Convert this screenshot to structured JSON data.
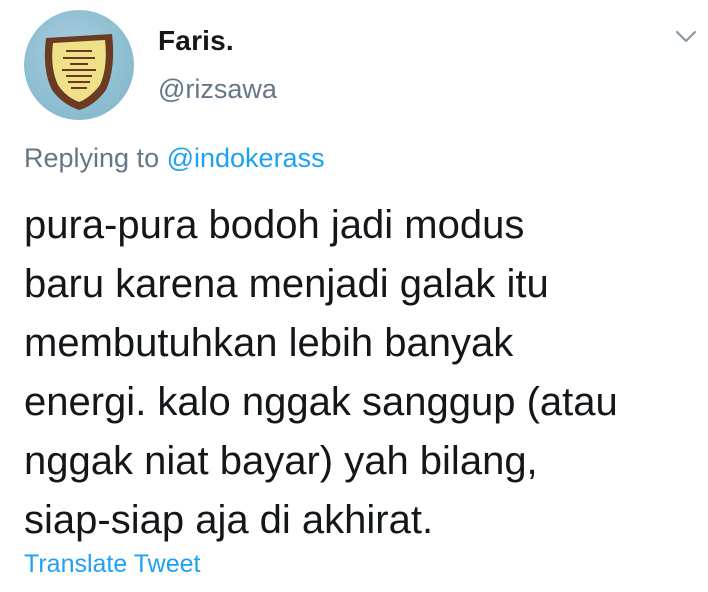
{
  "author": {
    "display_name": "Faris.",
    "username": "@rizsawa",
    "avatar_icon": "shield-plaque-icon"
  },
  "menu": {
    "icon": "chevron-down-icon"
  },
  "reply_context": {
    "prefix": "Replying to ",
    "handle": "@indokerass"
  },
  "tweet": {
    "lines": [
      "pura-pura bodoh jadi modus",
      "baru karena menjadi galak itu",
      "membutuhkan lebih banyak",
      "energi. kalo nggak sanggup (atau",
      "nggak niat bayar) yah bilang,",
      "siap-siap aja di akhirat."
    ]
  },
  "actions": {
    "translate_label": "Translate Tweet"
  },
  "colors": {
    "link": "#1da1f2",
    "secondary_text": "#657786",
    "primary_text": "#14171a",
    "avatar_background": "#8fbfd2"
  }
}
